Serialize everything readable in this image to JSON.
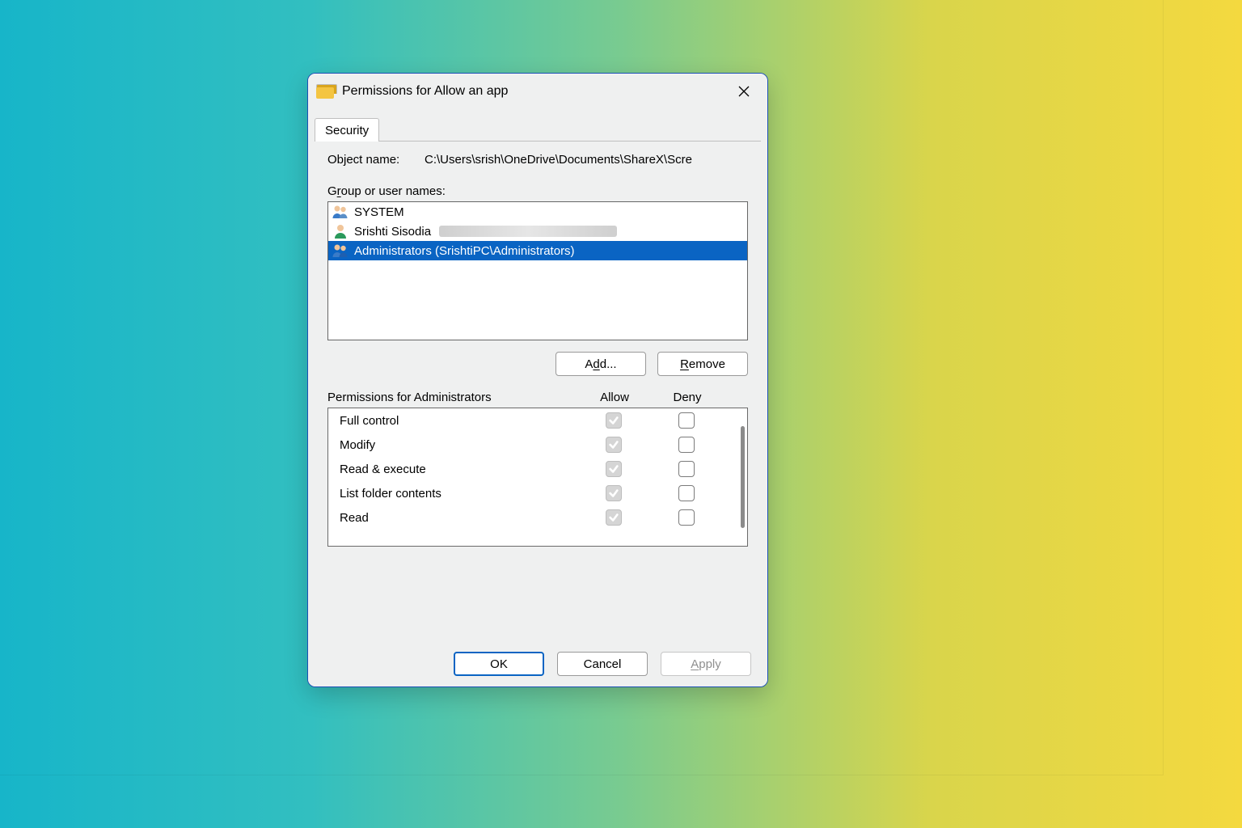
{
  "window": {
    "title": "Permissions for Allow an app"
  },
  "tabs": {
    "security": "Security"
  },
  "object": {
    "label": "Object name:",
    "path": "C:\\Users\\srish\\OneDrive\\Documents\\ShareX\\Scre"
  },
  "groups_label": {
    "pre": "G",
    "u": "r",
    "post": "oup or user names:"
  },
  "users": [
    {
      "name": "SYSTEM",
      "icon": "group",
      "selected": false,
      "redacted": false
    },
    {
      "name": "Srishti Sisodia",
      "icon": "user",
      "selected": false,
      "redacted": true
    },
    {
      "name": "Administrators (SrishtiPC\\Administrators)",
      "icon": "group",
      "selected": true,
      "redacted": false
    }
  ],
  "buttons": {
    "add_pre": "A",
    "add_u": "d",
    "add_post": "d...",
    "remove_pre": "",
    "remove_u": "R",
    "remove_post": "emove",
    "ok": "OK",
    "cancel": "Cancel",
    "apply_pre": "",
    "apply_u": "A",
    "apply_post": "pply"
  },
  "perm_header": {
    "name_pre": "",
    "name_u": "P",
    "name_post": "ermissions for Administrators",
    "allow": "Allow",
    "deny": "Deny"
  },
  "permissions": [
    {
      "label": "Full control",
      "allow": "disabled-checked",
      "deny": "unchecked"
    },
    {
      "label": "Modify",
      "allow": "disabled-checked",
      "deny": "unchecked"
    },
    {
      "label": "Read & execute",
      "allow": "disabled-checked",
      "deny": "unchecked"
    },
    {
      "label": "List folder contents",
      "allow": "disabled-checked",
      "deny": "unchecked"
    },
    {
      "label": "Read",
      "allow": "disabled-checked",
      "deny": "unchecked"
    }
  ]
}
